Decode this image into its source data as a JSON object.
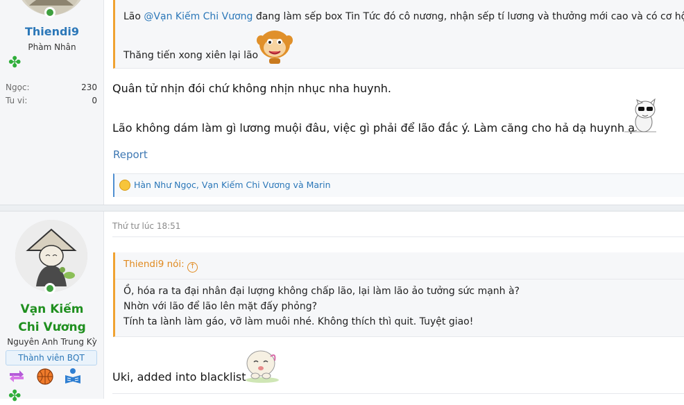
{
  "post1": {
    "author": {
      "name": "Thiendi9",
      "title": "Phàm Nhân",
      "stats": [
        {
          "label": "Ngọc:",
          "value": "230"
        },
        {
          "label": "Tu vi:",
          "value": "0"
        }
      ]
    },
    "quote": {
      "prefix": "Lão ",
      "mention": "@Vạn Kiếm Chi Vương",
      "text": " đang làm sếp box Tin Tức đó cô nương, nhận sếp tí lương và thưởng mới cao và có cơ hội thă",
      "line2": "Thăng tiến xong xiên lại lão"
    },
    "message": {
      "line1": "Quân tử nhịn đói chứ không nhịn nhục nha huynh.",
      "line2": "Lão không dám làm gì lương muội đâu, việc gì phải để lão đắc ý. Làm căng cho hả dạ huynh ạ"
    },
    "report_label": "Report",
    "reactions": "Hàn Như Ngọc, Vạn Kiếm Chi Vương và Marin"
  },
  "post2": {
    "author": {
      "name": "Vạn Kiếm Chi Vương",
      "title": "Nguyên Anh Trung Kỳ",
      "badge": "Thành viên BQT"
    },
    "date": "Thứ tư lúc 18:51",
    "quote": {
      "header": "Thiendi9 nói:",
      "lines": [
        "Ồ, hóa ra ta đại nhân đại lượng không chấp lão, lại làm lão ảo tưởng sức mạnh à?",
        "Nhờn với lão để lão lên mặt đấy phỏng?",
        "Tính ta lành làm gáo, vỡ làm muôi nhé. Không thích thì quit. Tuyệt giao!"
      ]
    },
    "message": "Uki, added into blacklist"
  },
  "colors": {
    "username": "#2b77b8",
    "staff_name": "#1f8f1f",
    "quote_accent": "#f0a232",
    "link": "#3e78b3"
  }
}
